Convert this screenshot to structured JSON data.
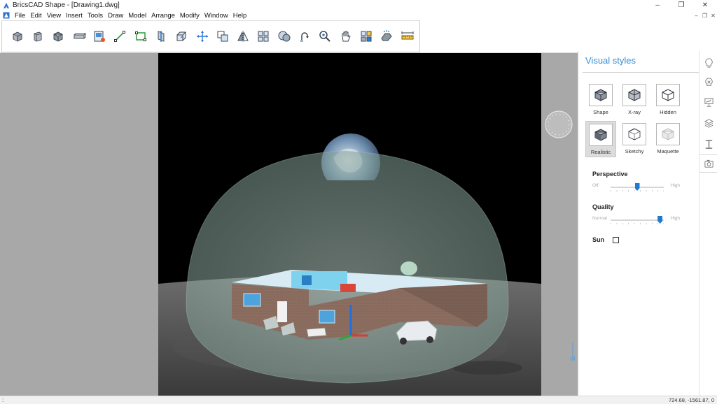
{
  "window": {
    "title": "BricsCAD Shape - [Drawing1.dwg]",
    "controls": [
      "–",
      "❐",
      "✕"
    ]
  },
  "menubar": {
    "items": [
      "File",
      "Edit",
      "View",
      "Insert",
      "Tools",
      "Draw",
      "Model",
      "Arrange",
      "Modify",
      "Window",
      "Help"
    ],
    "mdi_controls": [
      "–",
      "❐",
      "✕"
    ]
  },
  "toolbar": {
    "icons": [
      "box-solid-icon",
      "extrude-wall-icon",
      "cube-icon",
      "slab-icon",
      "window-insert-icon",
      "line-icon",
      "rectangle-icon",
      "section-plane-icon",
      "3d-box-icon",
      "move-icon",
      "copy-icon",
      "mirror-icon",
      "array-icon",
      "sphere-union-icon",
      "rotate-icon",
      "zoom-icon",
      "pan-hand-icon",
      "component-library-icon",
      "render-icon",
      "measure-icon"
    ]
  },
  "panel": {
    "title": "Visual styles",
    "styles": [
      {
        "label": "Shape"
      },
      {
        "label": "X-ray"
      },
      {
        "label": "Hidden"
      },
      {
        "label": "Realistic",
        "selected": true
      },
      {
        "label": "Sketchy"
      },
      {
        "label": "Maquette"
      }
    ],
    "perspective": {
      "label": "Perspective",
      "low": "Off",
      "high": "High",
      "value": 0.5
    },
    "quality": {
      "label": "Quality",
      "low": "Normal",
      "high": "High",
      "value": 0.93
    },
    "sun": {
      "label": "Sun",
      "checked": false
    }
  },
  "right_strip": {
    "icons": [
      "lightbulb-icon",
      "lightbulb-settings-icon",
      "presentation-icon",
      "layers-icon",
      "i-beam-icon",
      "camera-icon"
    ],
    "active": "camera-icon"
  },
  "status": {
    "coordinates": "724.68, -1561.87, 0",
    "grip": ":"
  },
  "colors": {
    "accent": "#3a8fd6",
    "slider": "#1f7ad6",
    "canvas_bg": "#a8a8a8",
    "viewport_bg": "#000000"
  }
}
